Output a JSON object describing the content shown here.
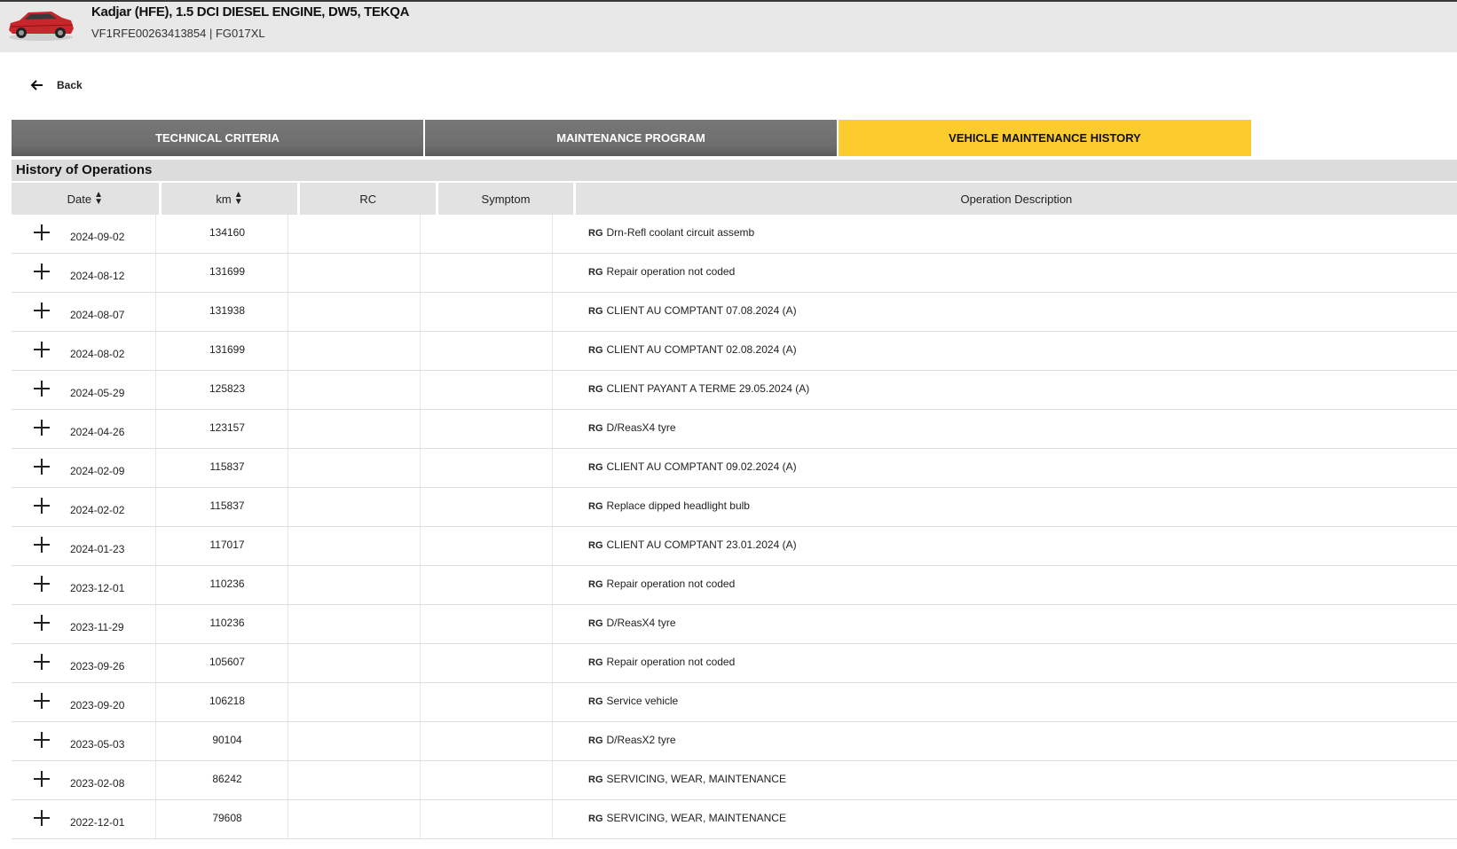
{
  "vehicle": {
    "title": "Kadjar (HFE), 1.5 DCI DIESEL ENGINE, DW5, TEKQA",
    "subtitle": "VF1RFE00263413854 | FG017XL",
    "car_color": "#c8262b"
  },
  "nav": {
    "back_label": "Back"
  },
  "tabs": [
    {
      "label": "TECHNICAL CRITERIA",
      "active": false
    },
    {
      "label": "MAINTENANCE PROGRAM",
      "active": false
    },
    {
      "label": "VEHICLE MAINTENANCE HISTORY",
      "active": true
    }
  ],
  "history": {
    "title": "History of Operations",
    "columns": [
      "Date",
      "km",
      "RC",
      "Symptom",
      "Operation Description"
    ],
    "rows": [
      {
        "date": "2024-09-02",
        "km": "134160",
        "rc": "",
        "symptom": "",
        "tag": "RG",
        "desc": "Drn-Refl coolant circuit assemb"
      },
      {
        "date": "2024-08-12",
        "km": "131699",
        "rc": "",
        "symptom": "",
        "tag": "RG",
        "desc": "Repair operation not coded"
      },
      {
        "date": "2024-08-07",
        "km": "131938",
        "rc": "",
        "symptom": "",
        "tag": "RG",
        "desc": "CLIENT AU COMPTANT 07.08.2024 (A)"
      },
      {
        "date": "2024-08-02",
        "km": "131699",
        "rc": "",
        "symptom": "",
        "tag": "RG",
        "desc": "CLIENT AU COMPTANT 02.08.2024 (A)"
      },
      {
        "date": "2024-05-29",
        "km": "125823",
        "rc": "",
        "symptom": "",
        "tag": "RG",
        "desc": "CLIENT PAYANT A TERME 29.05.2024 (A)"
      },
      {
        "date": "2024-04-26",
        "km": "123157",
        "rc": "",
        "symptom": "",
        "tag": "RG",
        "desc": "D/ReasX4 tyre"
      },
      {
        "date": "2024-02-09",
        "km": "115837",
        "rc": "",
        "symptom": "",
        "tag": "RG",
        "desc": "CLIENT AU COMPTANT 09.02.2024 (A)"
      },
      {
        "date": "2024-02-02",
        "km": "115837",
        "rc": "",
        "symptom": "",
        "tag": "RG",
        "desc": "Replace dipped headlight bulb"
      },
      {
        "date": "2024-01-23",
        "km": "117017",
        "rc": "",
        "symptom": "",
        "tag": "RG",
        "desc": "CLIENT AU COMPTANT 23.01.2024 (A)"
      },
      {
        "date": "2023-12-01",
        "km": "110236",
        "rc": "",
        "symptom": "",
        "tag": "RG",
        "desc": "Repair operation not coded"
      },
      {
        "date": "2023-11-29",
        "km": "110236",
        "rc": "",
        "symptom": "",
        "tag": "RG",
        "desc": "D/ReasX4 tyre"
      },
      {
        "date": "2023-09-26",
        "km": "105607",
        "rc": "",
        "symptom": "",
        "tag": "RG",
        "desc": "Repair operation not coded"
      },
      {
        "date": "2023-09-20",
        "km": "106218",
        "rc": "",
        "symptom": "",
        "tag": "RG",
        "desc": "Service vehicle"
      },
      {
        "date": "2023-05-03",
        "km": "90104",
        "rc": "",
        "symptom": "",
        "tag": "RG",
        "desc": "D/ReasX2 tyre"
      },
      {
        "date": "2023-02-08",
        "km": "86242",
        "rc": "",
        "symptom": "",
        "tag": "RG",
        "desc": "SERVICING, WEAR, MAINTENANCE"
      },
      {
        "date": "2022-12-01",
        "km": "79608",
        "rc": "",
        "symptom": "",
        "tag": "RG",
        "desc": "SERVICING, WEAR, MAINTENANCE"
      }
    ]
  },
  "colors": {
    "active_tab": "#fccb2e",
    "inactive_tab": "#6e6e6e",
    "header_bg": "#e8e8e8"
  }
}
